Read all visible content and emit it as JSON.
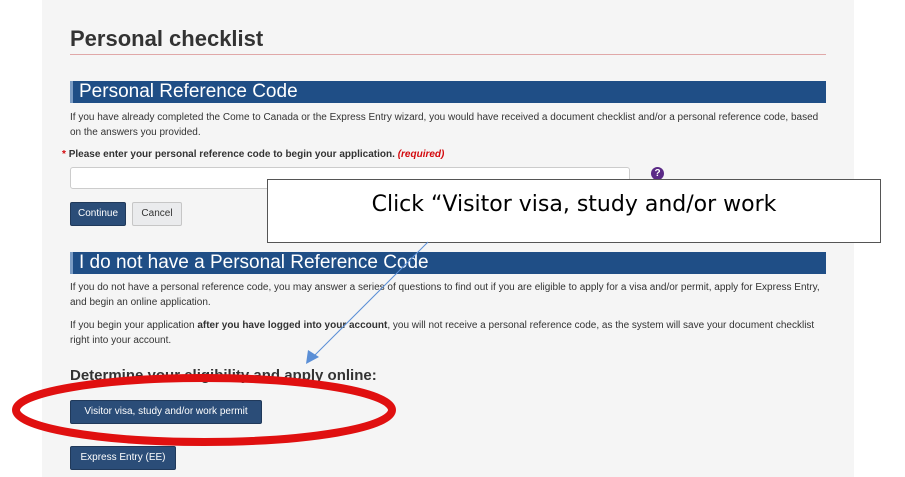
{
  "page": {
    "title": "Personal checklist"
  },
  "section_prc": {
    "heading": "Personal Reference Code",
    "description": "If you have already completed the Come to Canada or the Express Entry wizard, you would have received a document checklist and/or a personal reference code, based on the answers you provided.",
    "field_label_asterisk": "*",
    "field_label": "Please enter your personal reference code to begin your application.",
    "field_required": "(required)",
    "field_value": "",
    "help_icon": "question-circle-icon",
    "help_symbol": "?",
    "continue_label": "Continue",
    "cancel_label": "Cancel"
  },
  "section_no_prc": {
    "heading": "I do not have a Personal Reference Code",
    "description": "If you do not have a personal reference code, you may answer a series of questions to find out if you are eligible to apply for a visa and/or permit, apply for Express Entry, and begin an online application.",
    "note_prefix": "If you begin your application ",
    "note_bold": "after you have logged into your account",
    "note_suffix": ", you will not receive a personal reference code, as the system will save your document checklist right into your account.",
    "subheading": "Determine your eligibility and apply online:",
    "visitor_button": "Visitor visa, study and/or work permit",
    "express_button": "Express Entry (EE)"
  },
  "annotation": {
    "callout_text": "Click “Visitor visa, study and/or work",
    "callout_color": "#000000",
    "ellipse_color": "#e01010",
    "arrow_color": "#5b8fd6"
  },
  "colors": {
    "section_bar": "#1f4e86",
    "primary_button": "#2b4d78",
    "required": "#d3080c"
  }
}
